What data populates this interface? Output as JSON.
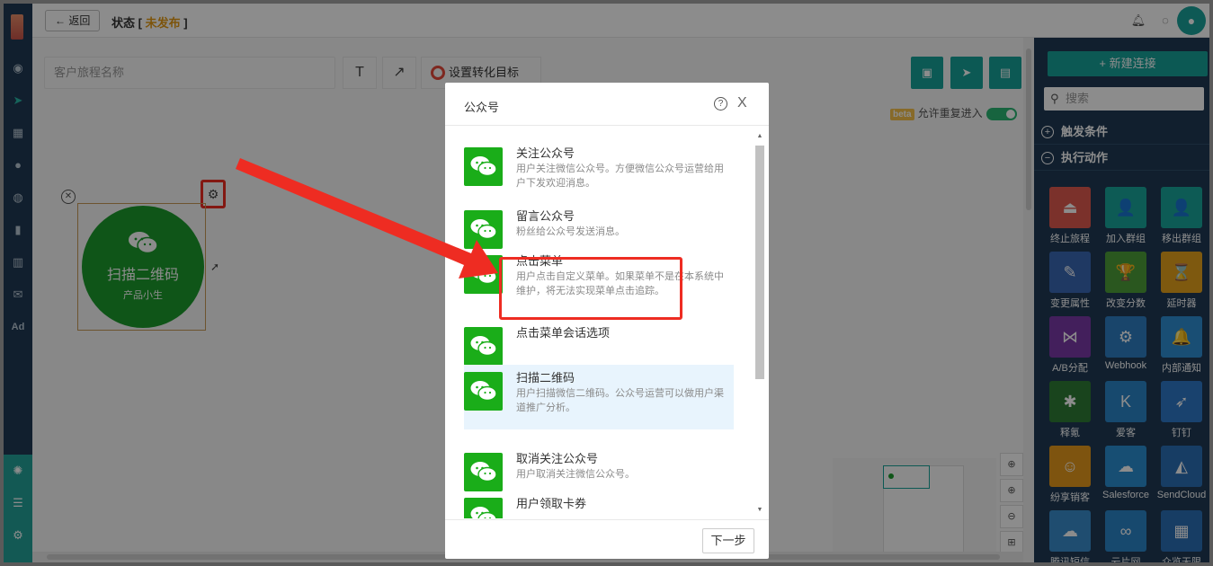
{
  "topbar": {
    "back_label": "← 返回",
    "status_label": "状态 [",
    "status_value": "未发布",
    "status_close": "]"
  },
  "toolbar": {
    "journey_name_placeholder": "客户旅程名称",
    "text_tool": "T",
    "arrow_tool": "↗",
    "goal_label": "设置转化目标",
    "beta_badge": "beta",
    "repeat_entry_label": "允许重复进入"
  },
  "node": {
    "title": "扫描二维码",
    "subtitle": "产品小生"
  },
  "right_panel": {
    "new_connection": "+ 新建连接",
    "search_placeholder": "搜索",
    "section_trigger": "触发条件",
    "section_actions": "执行动作",
    "actions": [
      {
        "label": "终止旅程",
        "color": "#e05a4f",
        "glyph": "⏏"
      },
      {
        "label": "加入群组",
        "color": "#19a79b",
        "glyph": "👤"
      },
      {
        "label": "移出群组",
        "color": "#19a79b",
        "glyph": "👤"
      },
      {
        "label": "变更属性",
        "color": "#3a68b5",
        "glyph": "✎"
      },
      {
        "label": "改变分数",
        "color": "#4d9e3a",
        "glyph": "🏆"
      },
      {
        "label": "延时器",
        "color": "#e6a21c",
        "glyph": "⌛"
      },
      {
        "label": "A/B分配",
        "color": "#7b3aa8",
        "glyph": "⋈"
      },
      {
        "label": "Webhook",
        "color": "#2f7fc4",
        "glyph": "⚙"
      },
      {
        "label": "内部通知",
        "color": "#2f8fd4",
        "glyph": "🔔"
      },
      {
        "label": "释氪",
        "color": "#2e7d35",
        "glyph": "✱"
      },
      {
        "label": "爱客",
        "color": "#2a86c9",
        "glyph": "K"
      },
      {
        "label": "钉钉",
        "color": "#2e78c8",
        "glyph": "➶"
      },
      {
        "label": "纷享销客",
        "color": "#e69a1c",
        "glyph": "☺"
      },
      {
        "label": "Salesforce",
        "color": "#2a8ed2",
        "glyph": "☁"
      },
      {
        "label": "SendCloud",
        "color": "#2a6fb6",
        "glyph": "◭"
      },
      {
        "label": "腾讯短信",
        "color": "#3a8dcc",
        "glyph": "☁"
      },
      {
        "label": "云片网",
        "color": "#2a86c9",
        "glyph": "∞"
      },
      {
        "label": "众览无限",
        "color": "#2a6fb6",
        "glyph": "▦"
      }
    ]
  },
  "modal": {
    "title": "公众号",
    "help": "?",
    "close": "X",
    "next_label": "下一步",
    "items": [
      {
        "title": "关注公众号",
        "desc": "用户关注微信公众号。方便微信公众号运营给用户下发欢迎消息。"
      },
      {
        "title": "留言公众号",
        "desc": "粉丝给公众号发送消息。"
      },
      {
        "title": "点击菜单",
        "desc": "用户点击自定义菜单。如果菜单不是在本系统中维护，将无法实现菜单点击追踪。"
      },
      {
        "title": "点击菜单会话选项",
        "desc": ""
      },
      {
        "title": "扫描二维码",
        "desc": "用户扫描微信二维码。公众号运营可以做用户渠道推广分析。"
      },
      {
        "title": "取消关注公众号",
        "desc": "用户取消关注微信公众号。"
      },
      {
        "title": "用户领取卡券",
        "desc": ""
      }
    ]
  },
  "colors": {
    "teal": "#16a39a",
    "navy": "#1f3a55",
    "wechat_green": "#1aad19",
    "highlight_red": "#ee2c22",
    "status_orange": "#e39a14"
  }
}
